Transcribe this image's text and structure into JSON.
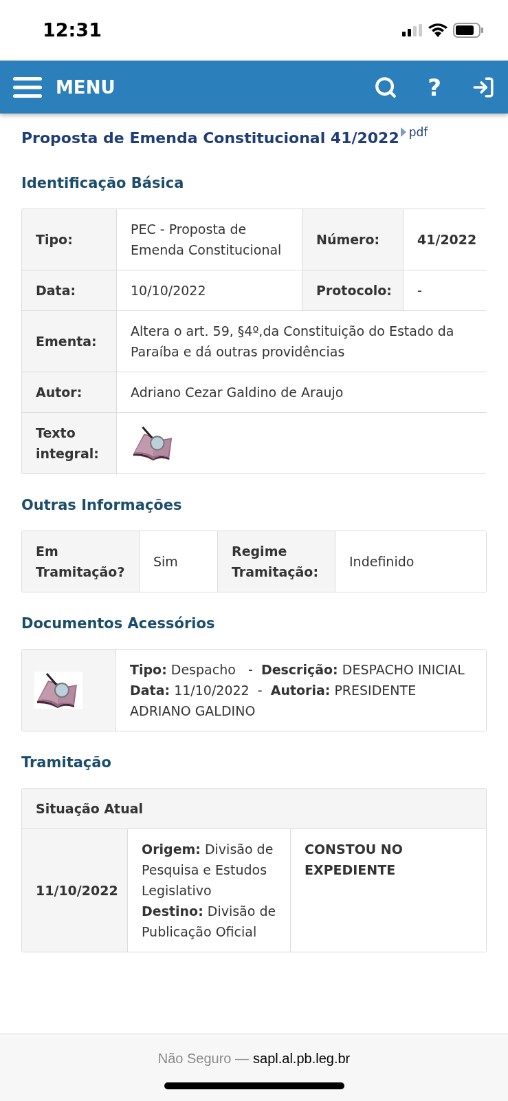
{
  "status_bar": {
    "time": "12:31"
  },
  "navbar": {
    "menu_label": "MENU",
    "help": "?"
  },
  "title": {
    "text": "Proposta de Emenda Constitucional 41/2022",
    "link": "pdf"
  },
  "basic_identification": {
    "heading": "Identificação Básica",
    "rows": [
      {
        "cells": [
          {
            "kind": "label",
            "text": "Tipo:"
          },
          {
            "kind": "value",
            "text": "PEC - Proposta de Emenda Constitucional"
          },
          {
            "kind": "label",
            "text": "Número:"
          },
          {
            "kind": "value",
            "text": "41/2022",
            "bold": true
          }
        ]
      },
      {
        "cells": [
          {
            "kind": "label",
            "text": "Data:"
          },
          {
            "kind": "value",
            "text": "10/10/2022"
          },
          {
            "kind": "label",
            "text": "Protocolo:"
          },
          {
            "kind": "value",
            "text": "-"
          }
        ]
      },
      {
        "cells": [
          {
            "kind": "label",
            "text": "Ementa:"
          },
          {
            "kind": "value",
            "text": "Altera o art. 59, §4º,da Constituição do Estado da Paraíba e dá outras providências"
          }
        ]
      },
      {
        "cells": [
          {
            "kind": "label",
            "text": "Autor:"
          },
          {
            "kind": "value",
            "text": "Adriano Cezar Galdino de Araujo"
          }
        ]
      },
      {
        "cells": [
          {
            "kind": "label",
            "text": "Texto integral:"
          },
          {
            "kind": "icon"
          }
        ]
      }
    ]
  },
  "other_info": {
    "heading": "Outras Informações",
    "cells": [
      {
        "kind": "label",
        "text": "Em Tramitação?"
      },
      {
        "kind": "value",
        "text": "Sim"
      },
      {
        "kind": "label",
        "text": "Regime Tramitação:"
      },
      {
        "kind": "value",
        "text": "Indefinido"
      }
    ]
  },
  "documents": {
    "heading": "Documentos Acessórios",
    "items": [
      {
        "lines": [
          "**Tipo:** Despacho   -  **Descrição:** DESPACHO INICIAL",
          "**Data:** 11/10/2022  -  **Autoria:** PRESIDENTE ADRIANO GALDINO"
        ]
      }
    ]
  },
  "tramitacao": {
    "heading": "Tramitação",
    "current_label": "Situação Atual",
    "rows": [
      {
        "date": "11/10/2022",
        "route": [
          "**Origem:** Divisão de Pesquisa e Estudos Legislativo",
          "**Destino:** Divisão de Publicação Oficial"
        ],
        "status": "CONSTOU NO EXPEDIENTE"
      }
    ]
  },
  "browser_bar": {
    "security": "Não Seguro —",
    "domain": "sapl.al.pb.leg.br"
  }
}
